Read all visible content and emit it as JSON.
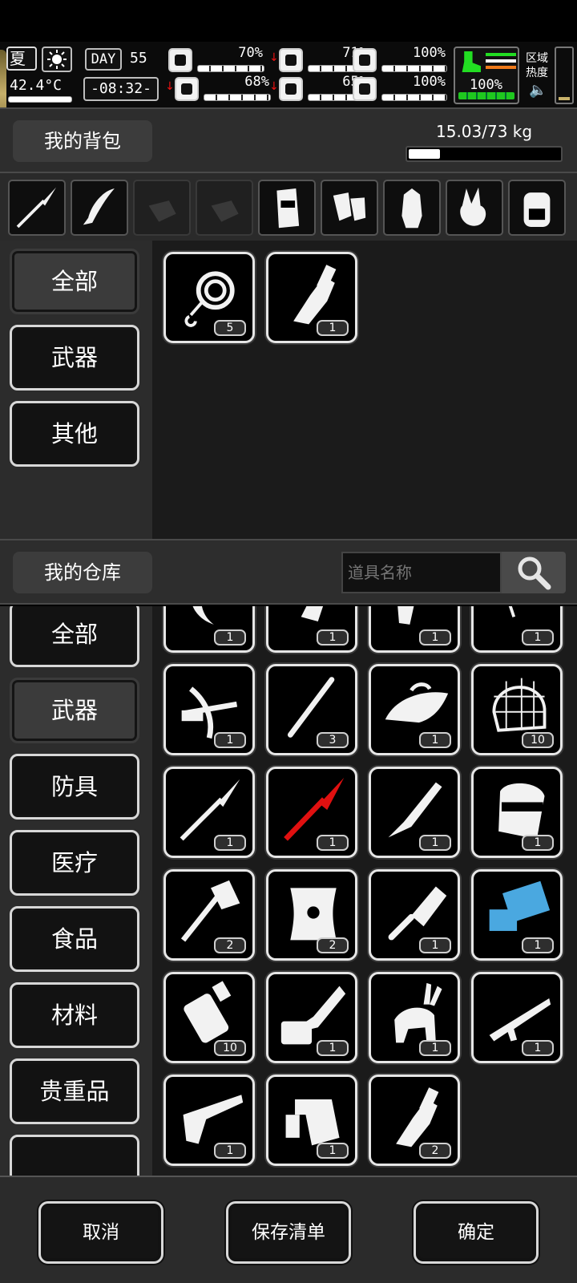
{
  "hud": {
    "season": "夏",
    "temperature": "42.4°C",
    "day_label": "DAY",
    "day_number": "55",
    "time": "-08:32-",
    "stats": [
      {
        "name": "health",
        "value": "70%",
        "level": 0.7,
        "down": false
      },
      {
        "name": "hunger",
        "value": "71%",
        "level": 0.71,
        "down": true
      },
      {
        "name": "energy",
        "value": "100%",
        "level": 1.0,
        "down": false
      },
      {
        "name": "mind",
        "value": "68%",
        "level": 0.68,
        "down": true
      },
      {
        "name": "thirst",
        "value": "65%",
        "level": 0.65,
        "down": true
      },
      {
        "name": "heart",
        "value": "100%",
        "level": 1.0,
        "down": false
      }
    ],
    "stamina": {
      "value": "100%",
      "level": 1.0
    },
    "area_heat_label": "区域\n热度",
    "colors": {
      "stamina": "#22dd22",
      "alert": "#ee1111"
    }
  },
  "backpack": {
    "title": "我的背包",
    "weight": "15.03/73 kg",
    "weight_level": 0.206,
    "filters": [
      "spear-icon",
      "machete-icon",
      "glove-icon",
      "glove-icon",
      "armor-vest-icon",
      "gloves-icon",
      "raccoon-costume-icon",
      "rabbit-mask-icon",
      "backpack-icon"
    ],
    "categories": [
      {
        "label": "全部",
        "active": true
      },
      {
        "label": "武器",
        "active": false
      },
      {
        "label": "其他",
        "active": false
      }
    ],
    "items": [
      {
        "icon": "rope-icon",
        "qty": "5"
      },
      {
        "icon": "axe-blade-icon",
        "qty": "1"
      }
    ]
  },
  "warehouse": {
    "title": "我的仓库",
    "search_placeholder": "道具名称",
    "categories": [
      {
        "label": "全部",
        "active": false
      },
      {
        "label": "武器",
        "active": true
      },
      {
        "label": "防具",
        "active": false
      },
      {
        "label": "医疗",
        "active": false
      },
      {
        "label": "食品",
        "active": false
      },
      {
        "label": "材料",
        "active": false
      },
      {
        "label": "贵重品",
        "active": false
      }
    ],
    "items": [
      {
        "icon": "sickle-icon",
        "qty": "1"
      },
      {
        "icon": "knife-icon",
        "qty": "1"
      },
      {
        "icon": "revolver-icon",
        "qty": "1"
      },
      {
        "icon": "coil-icon",
        "qty": "1"
      },
      {
        "icon": "crossbow-icon",
        "qty": "1"
      },
      {
        "icon": "staff-icon",
        "qty": "3"
      },
      {
        "icon": "iron-icon",
        "qty": "1"
      },
      {
        "icon": "net-icon",
        "qty": "10"
      },
      {
        "icon": "spear-icon",
        "qty": "1"
      },
      {
        "icon": "red-spear-icon",
        "qty": "1"
      },
      {
        "icon": "dagger-icon",
        "qty": "1"
      },
      {
        "icon": "riot-shield-icon",
        "qty": "1"
      },
      {
        "icon": "axe-icon",
        "qty": "2"
      },
      {
        "icon": "round-shield-icon",
        "qty": "2"
      },
      {
        "icon": "cleaver-icon",
        "qty": "1"
      },
      {
        "icon": "minigun-icon",
        "qty": "1"
      },
      {
        "icon": "grenade-icon",
        "qty": "10"
      },
      {
        "icon": "chainsaw-icon",
        "qty": "1"
      },
      {
        "icon": "rabbit-horse-icon",
        "qty": "1"
      },
      {
        "icon": "rifle-icon",
        "qty": "1"
      },
      {
        "icon": "pistol-icon",
        "qty": "1"
      },
      {
        "icon": "flamethrower-icon",
        "qty": "1"
      },
      {
        "icon": "axe-blade-icon",
        "qty": "2"
      }
    ]
  },
  "footer": {
    "cancel": "取消",
    "save_list": "保存清单",
    "confirm": "确定"
  }
}
